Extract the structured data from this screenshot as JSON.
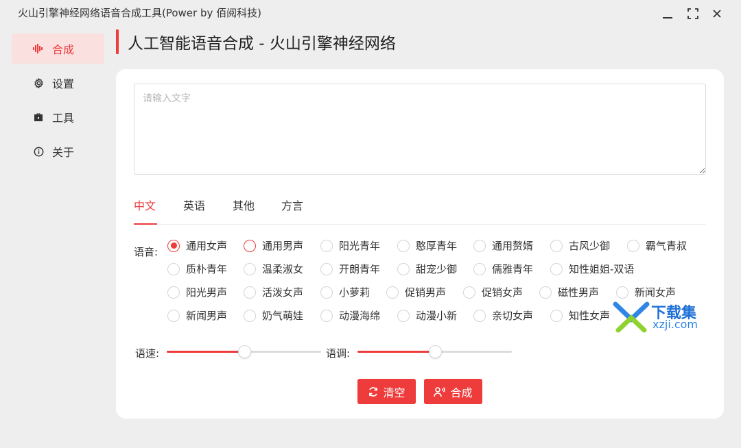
{
  "window": {
    "title": "火山引擎神经网络语音合成工具(Power by 佰阅科技)"
  },
  "sidebar": {
    "items": [
      {
        "label": "合成",
        "icon": "waveform-icon",
        "active": true
      },
      {
        "label": "设置",
        "icon": "gear-icon",
        "active": false
      },
      {
        "label": "工具",
        "icon": "toolbox-icon",
        "active": false
      },
      {
        "label": "关于",
        "icon": "info-icon",
        "active": false
      }
    ]
  },
  "header": {
    "title": "人工智能语音合成 - 火山引擎神经网络"
  },
  "input": {
    "placeholder": "请输入文字",
    "value": ""
  },
  "tabs": [
    {
      "label": "中文",
      "active": true
    },
    {
      "label": "英语",
      "active": false
    },
    {
      "label": "其他",
      "active": false
    },
    {
      "label": "方言",
      "active": false
    }
  ],
  "voice": {
    "label": "语音:",
    "selected": "通用女声",
    "options": [
      [
        "通用女声",
        "通用男声",
        "阳光青年",
        "憨厚青年",
        "通用赘婿",
        "古风少御",
        "霸气青叔"
      ],
      [
        "质朴青年",
        "温柔淑女",
        "开朗青年",
        "甜宠少御",
        "儒雅青年",
        "知性姐姐-双语"
      ],
      [
        "阳光男声",
        "活泼女声",
        "小萝莉",
        "促销男声",
        "促销女声",
        "磁性男声",
        "新闻女声"
      ],
      [
        "新闻男声",
        "奶气萌娃",
        "动漫海绵",
        "动漫小新",
        "亲切女声",
        "知性女声"
      ]
    ]
  },
  "sliders": {
    "speed": {
      "label": "语速:",
      "value": 0.5
    },
    "pitch": {
      "label": "语调:",
      "value": 0.5
    }
  },
  "buttons": {
    "clear": "清空",
    "synthesize": "合成"
  },
  "watermark": {
    "brand": "下载集",
    "domain": "xzji.com"
  },
  "colors": {
    "accent": "#ee3b3b",
    "active_bg": "#fbe0e0",
    "watermark_blue": "#1e6fd6"
  }
}
